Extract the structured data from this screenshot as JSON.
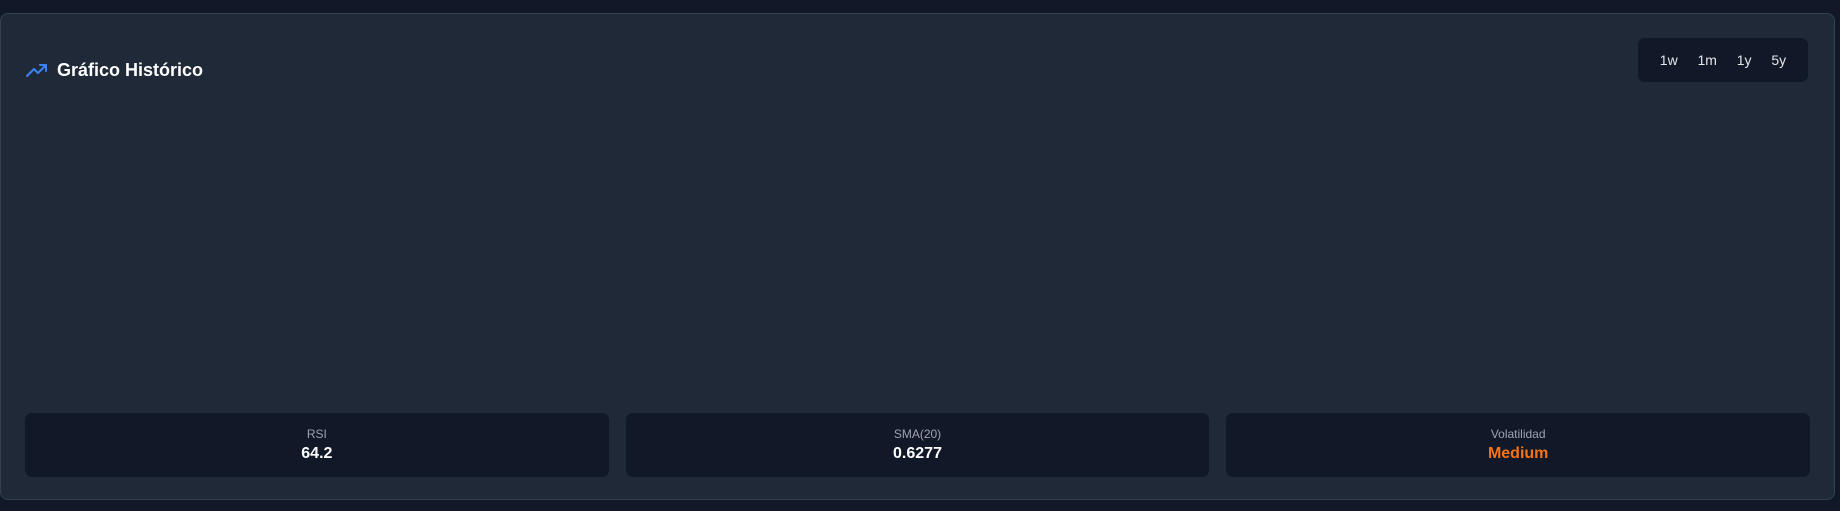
{
  "header": {
    "title": "Gráfico Histórico",
    "icon": "trending-up-icon",
    "icon_color": "#3b82f6"
  },
  "periods": [
    "1w",
    "1m",
    "1y",
    "5y"
  ],
  "stats": [
    {
      "label": "RSI",
      "value": "64.2",
      "color": "#ffffff"
    },
    {
      "label": "SMA(20)",
      "value": "0.6277",
      "color": "#ffffff"
    },
    {
      "label": "Volatilidad",
      "value": "Medium",
      "color": "#f97316"
    }
  ],
  "colors": {
    "page_bg": "#111827",
    "card_bg": "#1f2937",
    "inner_bg": "#111827",
    "accent": "#3b82f6",
    "warning": "#f97316"
  }
}
